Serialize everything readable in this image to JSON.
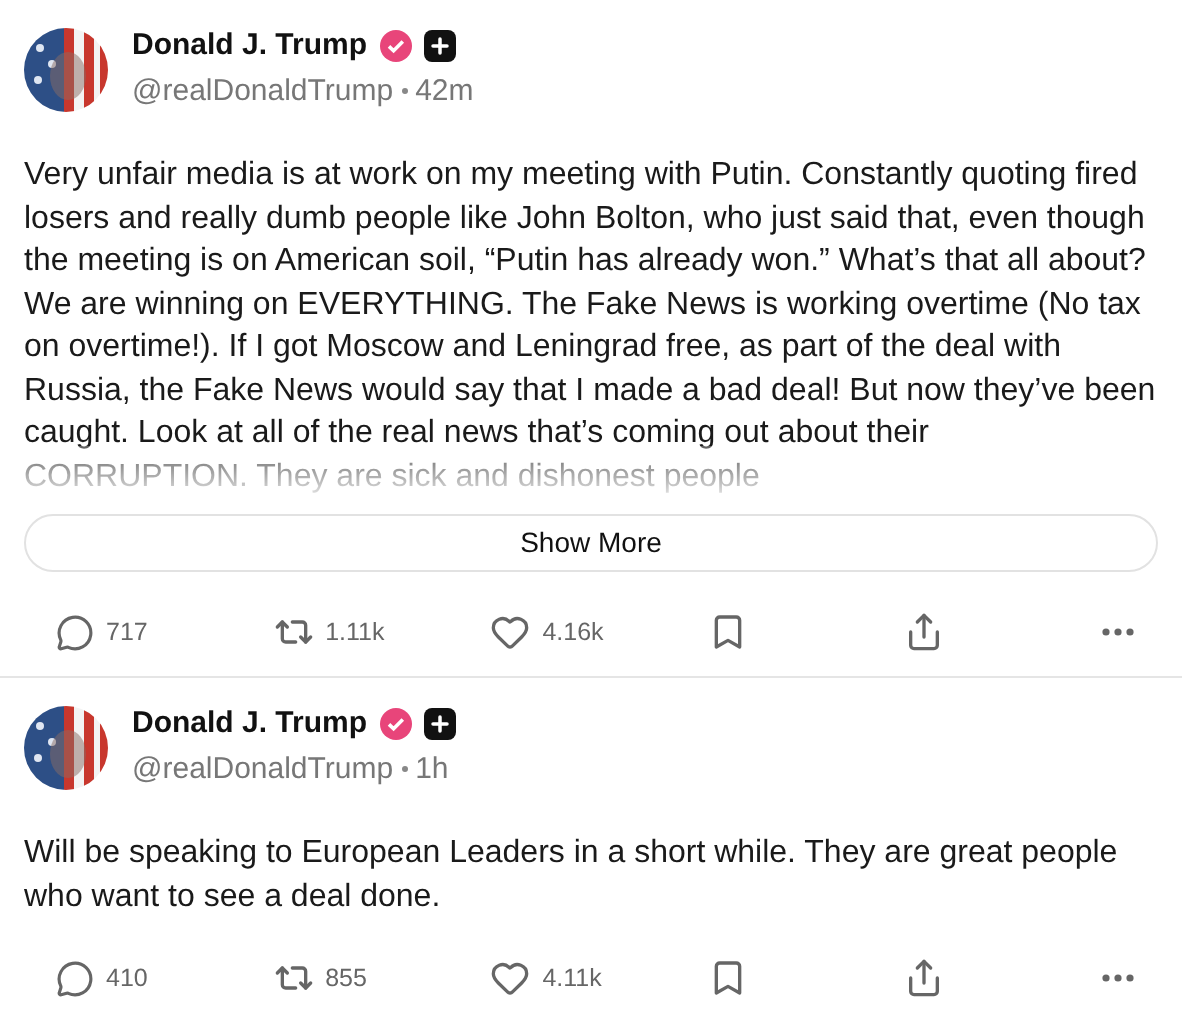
{
  "posts": [
    {
      "author": "Donald J. Trump",
      "verified": true,
      "handle": "@realDonaldTrump",
      "time": "42m",
      "text": "Very unfair media is at work on my meeting with Putin. Constantly quoting fired losers and really dumb people like John Bolton, who just said that, even though the meeting is on American soil, “Putin has already won.” What’s that all about? We are winning on EVERYTHING. The Fake News is working overtime (No tax on overtime!). If I got Moscow and Leningrad free, as part of the deal with Russia, the Fake News would say that I made a bad deal! But now they’ve been caught. Look at all of the real news that’s coming out about their CORRUPTION. They are sick and dishonest people",
      "truncated": true,
      "show_more": "Show More",
      "replies": "717",
      "reposts": "1.11k",
      "likes": "4.16k"
    },
    {
      "author": "Donald J. Trump",
      "verified": true,
      "handle": "@realDonaldTrump",
      "time": "1h",
      "text": "Will be speaking to European Leaders in a short while. They are great people who want to see a deal done.",
      "truncated": false,
      "replies": "410",
      "reposts": "855",
      "likes": "4.11k"
    }
  ]
}
